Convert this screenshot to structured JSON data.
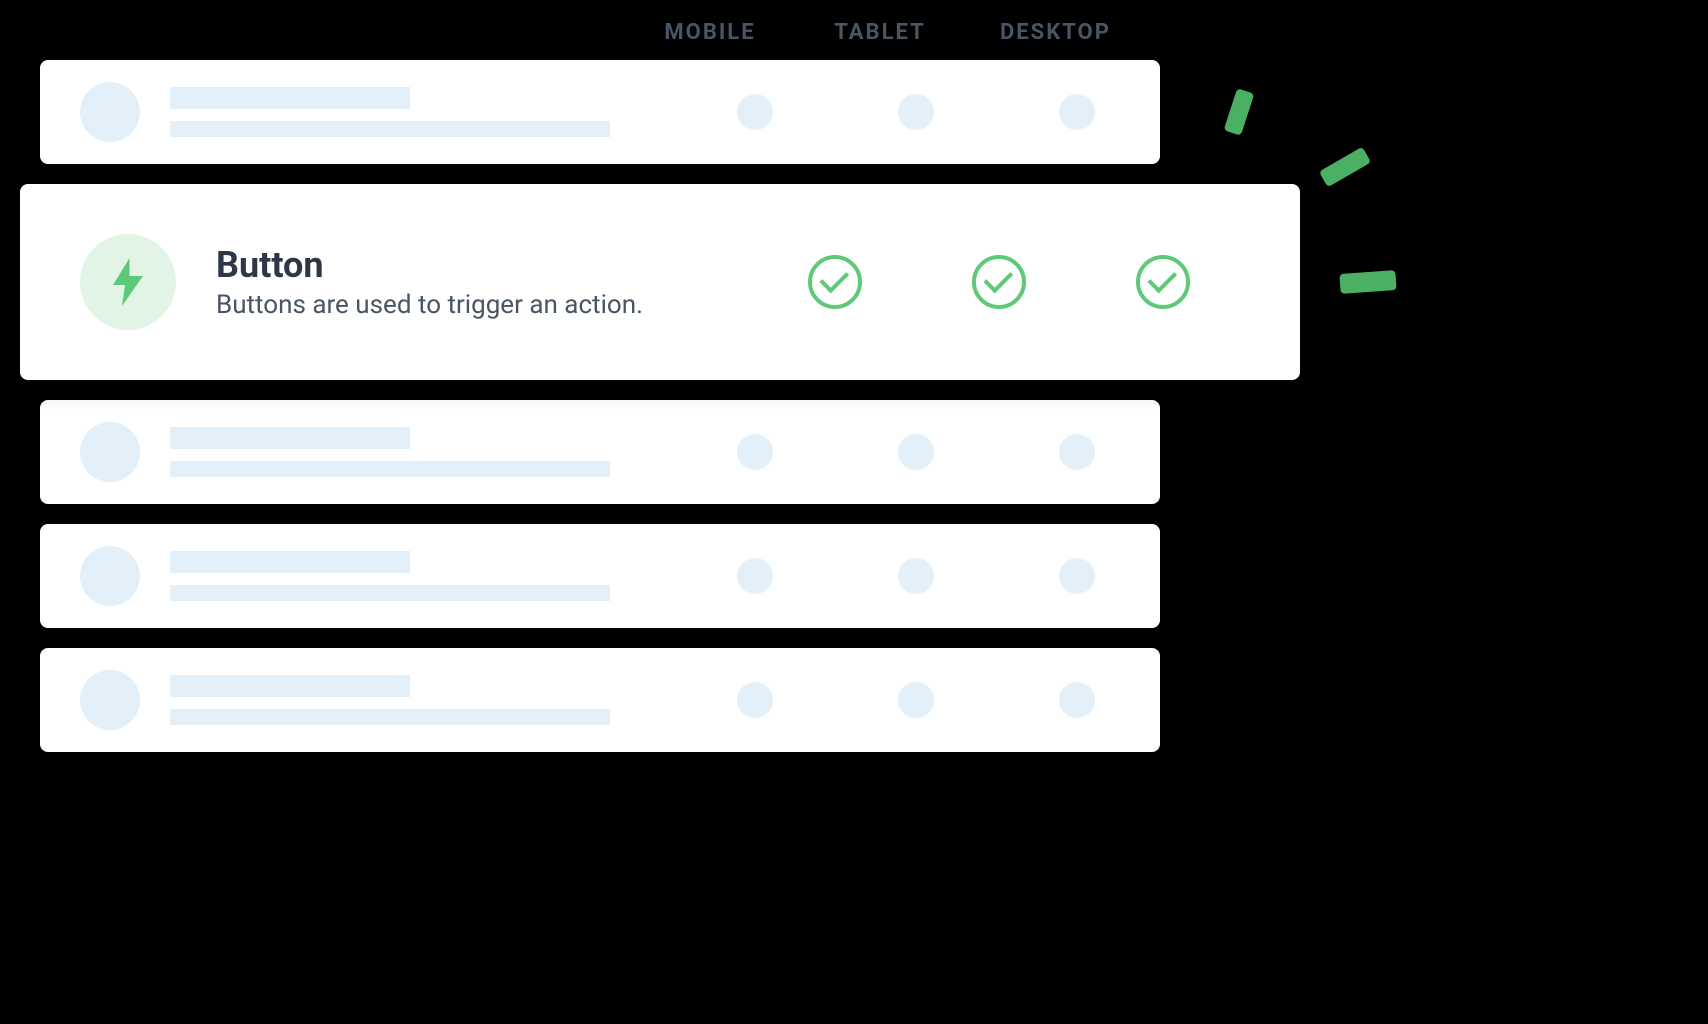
{
  "headers": {
    "mobile": "MOBILE",
    "tablet": "TABLET",
    "desktop": "DESKTOP"
  },
  "highlighted": {
    "title": "Button",
    "description": "Buttons are used to trigger an action.",
    "icon": "bolt-icon",
    "status": {
      "mobile": "checked",
      "tablet": "checked",
      "desktop": "checked"
    }
  },
  "colors": {
    "accent": "#5fc97a",
    "accentDark": "#4bb063",
    "accentLight": "#e2f4e6",
    "placeholder": "#e3f0fa",
    "textPrimary": "#2d3748",
    "textSecondary": "#4a5563"
  }
}
